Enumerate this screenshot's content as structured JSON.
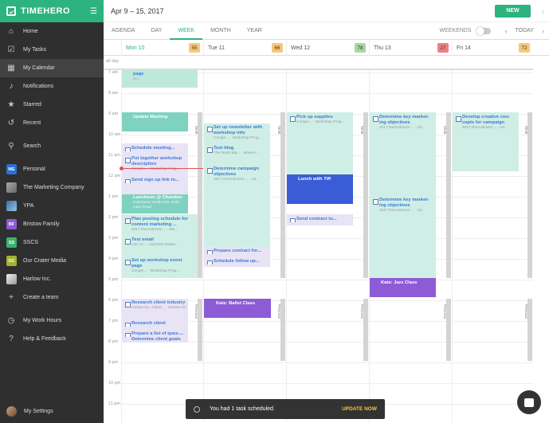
{
  "brand": {
    "name": "TIMEHERO"
  },
  "sidebar": {
    "items": [
      {
        "label": "Home",
        "icon": "home-icon"
      },
      {
        "label": "My Tasks",
        "icon": "checkbox-icon"
      },
      {
        "label": "My Calendar",
        "icon": "calendar-icon",
        "active": true
      },
      {
        "label": "Notifications",
        "icon": "bell-icon"
      },
      {
        "label": "Starred",
        "icon": "star-icon"
      },
      {
        "label": "Recent",
        "icon": "history-icon"
      },
      {
        "label": "Search",
        "icon": "search-icon"
      },
      {
        "label": "Personal",
        "badge": "ME",
        "color": "#2a6fd6"
      },
      {
        "label": "The Marketing Company",
        "avatar": true
      },
      {
        "label": "YPA",
        "avatar": true
      },
      {
        "label": "Bristow Family",
        "badge": "BF",
        "color": "#8e5bd6"
      },
      {
        "label": "SSCS",
        "badge": "SS",
        "color": "#3bb36b"
      },
      {
        "label": "Our Crater Media",
        "badge": "OC",
        "color": "#a3b32d"
      },
      {
        "label": "Harlow Inc.",
        "avatar": true
      },
      {
        "label": "Create a team",
        "icon": "plus-icon"
      },
      {
        "label": "My Work Hours",
        "icon": "clock-icon"
      },
      {
        "label": "Help & Feedback",
        "icon": "help-icon"
      }
    ],
    "settings_label": "My Settings"
  },
  "topbar": {
    "range": "Apr 9 – 15, 2017",
    "new_label": "NEW"
  },
  "viewbar": {
    "tabs": [
      "AGENDA",
      "DAY",
      "WEEK",
      "MONTH",
      "YEAR"
    ],
    "active_tab": "WEEK",
    "weekends_label": "WEEKENDS",
    "today_label": "TODAY"
  },
  "days": [
    {
      "label": "Mon 10",
      "hours": "55",
      "color": "#f7c87a",
      "today": true
    },
    {
      "label": "Tue 11",
      "hours": "66",
      "color": "#f7c87a"
    },
    {
      "label": "Wed 12",
      "hours": "78",
      "color": "#a8d8a0"
    },
    {
      "label": "Thu 13",
      "hours": "27",
      "color": "#f08080"
    },
    {
      "label": "Fri 14",
      "hours": "72",
      "color": "#f7c87a"
    }
  ],
  "allday_label": "all day",
  "hour_labels": [
    "7 am",
    "8 am",
    "9 am",
    "10 am",
    "11 am",
    "12 pm",
    "1 pm",
    "2 pm",
    "3 pm",
    "4 pm",
    "5 pm",
    "6 pm",
    "7 pm",
    "8 pm",
    "9 pm",
    "10 pm",
    "11 pm"
  ],
  "strip_labels": {
    "work": "Work",
    "personal": "Personal"
  },
  "events": {
    "mon": [
      {
        "title": "page",
        "sub": "Sc..."
      },
      {
        "title": "Update Meeting",
        "sub": ""
      },
      {
        "title": "Schedule meeting...",
        "sub": ""
      },
      {
        "title": "Put together workshop description",
        "sub": "Congin... · Workshop Prog..."
      },
      {
        "title": "Send sign up link to...",
        "sub": ""
      },
      {
        "title": "Luncheon @ Chamber",
        "sub": "Ristorante Verdicchio, Kelly Lake Road"
      },
      {
        "title": "Plan posting schedule for content marketing ...",
        "sub": "2017 Recruitment ... · Ma..."
      },
      {
        "title": "Test email",
        "sub": "Our Cr... · Summer Marke..."
      },
      {
        "title": "Set up workshop event page",
        "sub": "Congin... · Workshop Prog..."
      },
      {
        "title": "Research client industry",
        "sub": "Harlow Inc. Client... · Harlow Inc."
      },
      {
        "title": "Research client",
        "sub": ""
      },
      {
        "title": "Prepare a list of ques-...",
        "sub": ""
      },
      {
        "title": "Determine client goals",
        "sub": ""
      }
    ],
    "tue": [
      {
        "title": "Set up newsletter with workshop info",
        "sub": "Congin... · Workshop Prog..."
      },
      {
        "title": "Text blog",
        "sub": "The North Ma... · Novem..."
      },
      {
        "title": "Determine campaign objectives",
        "sub": "2017 Recruitment ... · Ad..."
      },
      {
        "title": "Prepare contract for...",
        "sub": ""
      },
      {
        "title": "Schedule follow up...",
        "sub": ""
      },
      {
        "title": "Kate: Ballet Class",
        "sub": ""
      }
    ],
    "wed": [
      {
        "title": "Pick up supplies",
        "sub": "Congin... · Workshop Prog..."
      },
      {
        "title": "Lunch with Tiff",
        "sub": ""
      },
      {
        "title": "Send contract to...",
        "sub": ""
      }
    ],
    "thu": [
      {
        "title": "Determine key market-ing objectives",
        "sub": "2017 Recruitment ... · Ad..."
      },
      {
        "title": "Determine key market-ing objectives",
        "sub": "2017 Recruitment ... · Ad..."
      },
      {
        "title": "Kate: Jazz Class",
        "sub": ""
      }
    ],
    "fri": [
      {
        "title": "Develop creative con-cepts for campaign",
        "sub": "2017 Recruitment ... · Ad..."
      }
    ]
  },
  "toast": {
    "message": "You had 1 task scheduled.",
    "action": "UPDATE NOW"
  },
  "colors": {
    "accent": "#2db37d",
    "teal": "#7fd1c0",
    "purple": "#8e5bd6",
    "blue": "#3a5cd6",
    "now": "#e05252"
  }
}
